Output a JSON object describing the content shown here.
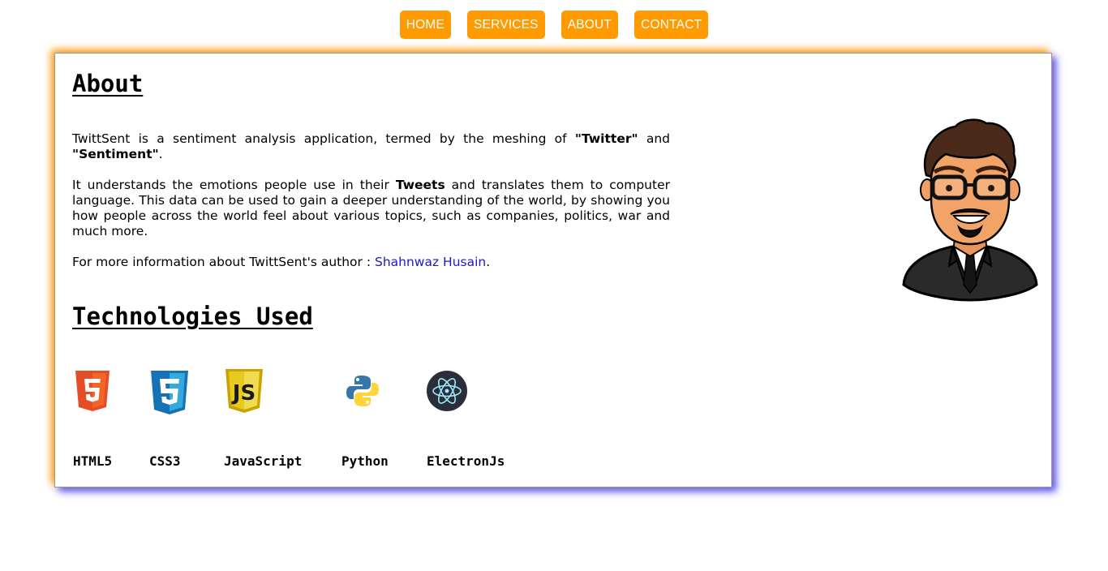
{
  "nav": {
    "items": [
      {
        "label": "HOME"
      },
      {
        "label": "SERVICES"
      },
      {
        "label": "ABOUT"
      },
      {
        "label": "CONTACT"
      }
    ]
  },
  "about": {
    "title": "About",
    "p1_pre": "TwittSent is a sentiment analysis application, termed by the meshing of ",
    "p1_bold1": "\"Twitter\"",
    "p1_mid": " and ",
    "p1_bold2": "\"Sentiment\"",
    "p1_post": ".",
    "p2_pre": "It understands the emotions people use in their ",
    "p2_bold": "Tweets",
    "p2_post": " and translates them to computer language. This data can be used to gain a deeper understanding of the world, by showing you how people across the world feel about various topics, such as companies, politics, war and much more.",
    "p3_pre": "For more information about TwittSent's author : ",
    "author_link": "Shahnwaz Husain",
    "p3_post": "."
  },
  "technologies": {
    "title": "Technologies Used",
    "items": [
      {
        "label": "HTML5",
        "icon": "html5-icon",
        "color": "#e44d26"
      },
      {
        "label": "CSS3",
        "icon": "css3-icon",
        "color": "#1572b6"
      },
      {
        "label": "JavaScript",
        "icon": "javascript-icon",
        "color": "#f0db4f"
      },
      {
        "label": "Python",
        "icon": "python-icon",
        "color": "#3776ab"
      },
      {
        "label": "ElectronJs",
        "icon": "electron-icon",
        "color": "#2b2e3a"
      }
    ]
  },
  "colors": {
    "nav_bg": "#ff9a00",
    "link": "#1a1ac8",
    "shadow_orange": "#ff9600",
    "shadow_blue": "#4646ff"
  }
}
